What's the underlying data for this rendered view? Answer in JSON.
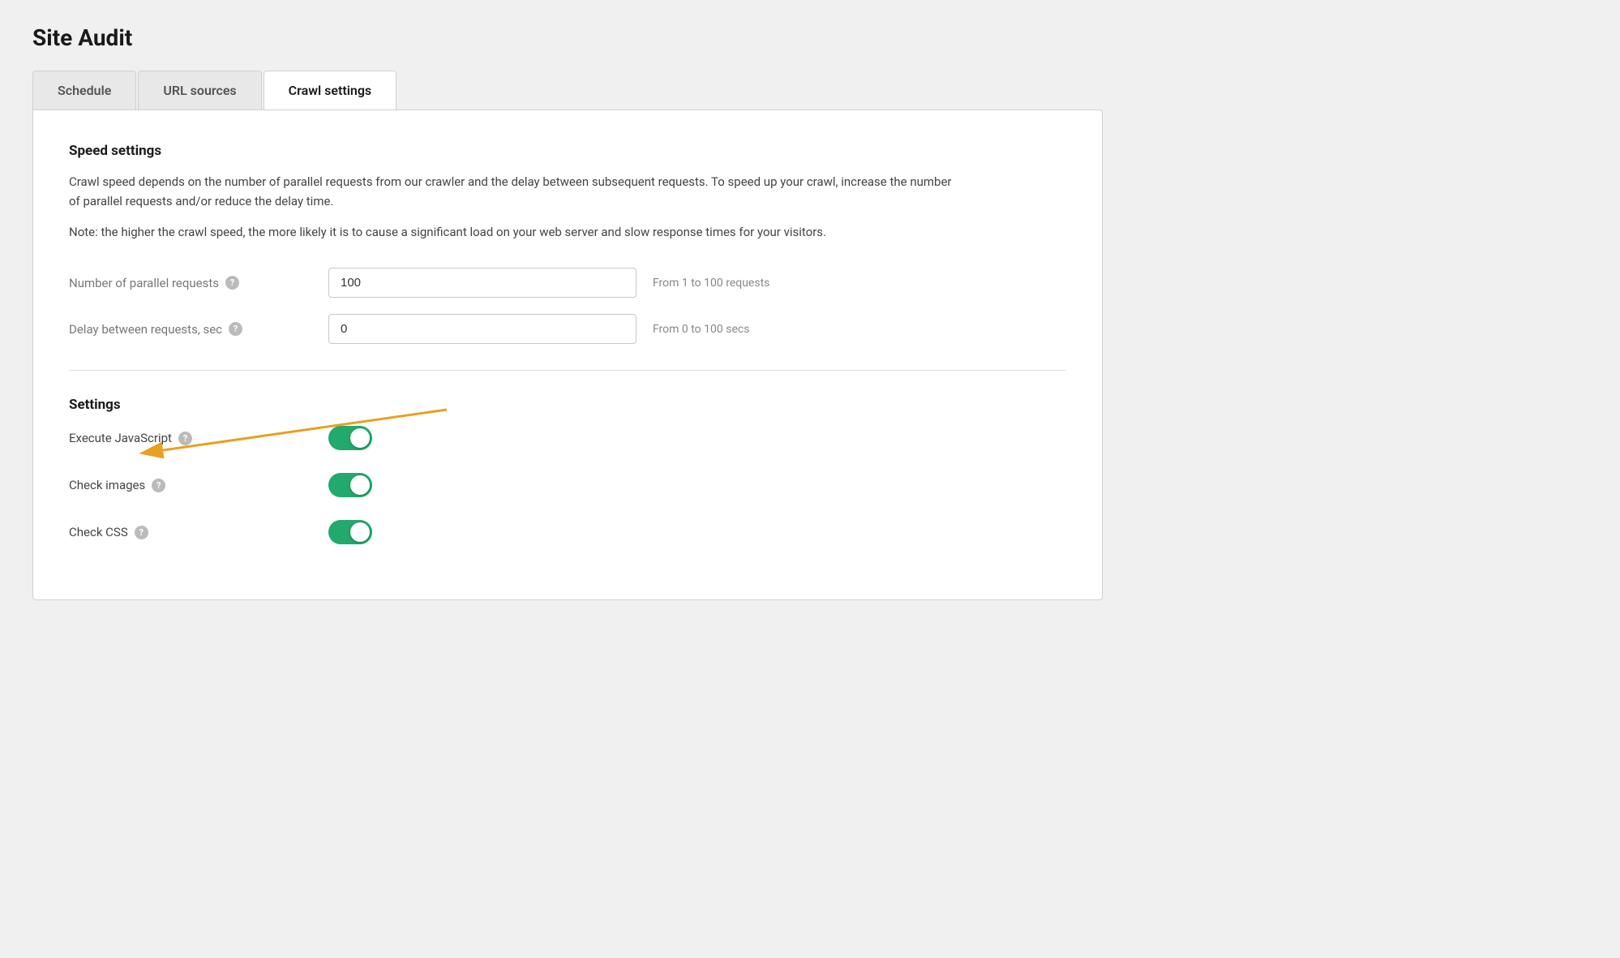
{
  "page": {
    "title": "Site Audit"
  },
  "tabs": [
    {
      "id": "schedule",
      "label": "Schedule",
      "active": false
    },
    {
      "id": "url-sources",
      "label": "URL sources",
      "active": false
    },
    {
      "id": "crawl-settings",
      "label": "Crawl settings",
      "active": true
    }
  ],
  "speed_settings": {
    "section_title": "Speed settings",
    "description": "Crawl speed depends on the number of parallel requests from our crawler and the delay between subsequent requests. To speed up your crawl, increase the number of parallel requests and/or reduce the delay time.",
    "note": "Note: the higher the crawl speed, the more likely it is to cause a significant load on your web server and slow response times for your visitors.",
    "fields": [
      {
        "id": "parallel-requests",
        "label": "Number of parallel requests",
        "value": "100",
        "hint": "From 1 to 100 requests",
        "has_help": true
      },
      {
        "id": "delay-requests",
        "label": "Delay between requests, sec",
        "value": "0",
        "hint": "From 0 to 100 secs",
        "has_help": true
      }
    ]
  },
  "settings": {
    "section_title": "Settings",
    "toggles": [
      {
        "id": "execute-javascript",
        "label": "Execute JavaScript",
        "enabled": true,
        "has_help": true,
        "has_arrow": true
      },
      {
        "id": "check-images",
        "label": "Check images",
        "enabled": true,
        "has_help": true,
        "has_arrow": false
      },
      {
        "id": "check-css",
        "label": "Check CSS",
        "enabled": true,
        "has_help": true,
        "has_arrow": false
      }
    ]
  },
  "icons": {
    "help": "?"
  },
  "colors": {
    "toggle_on": "#22a96e",
    "arrow": "#e8a020"
  }
}
